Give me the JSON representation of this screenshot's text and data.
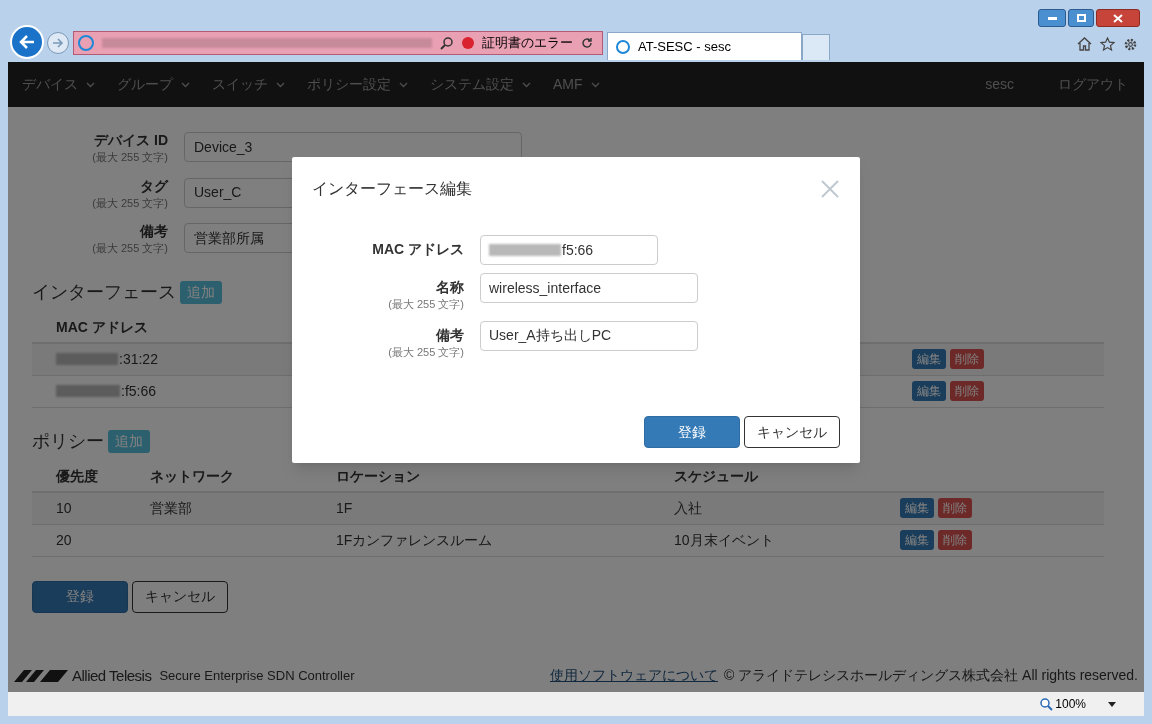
{
  "browser": {
    "cert_error": "証明書のエラー",
    "tab_title": "AT-SESC - sesc",
    "zoom": "100%"
  },
  "navbar": {
    "menus": [
      "デバイス",
      "グループ",
      "スイッチ",
      "ポリシー設定",
      "システム設定",
      "AMF"
    ],
    "user": "sesc",
    "logout": "ログアウト"
  },
  "device_form": [
    {
      "label": "デバイス ID",
      "hint": "(最大 255 文字)",
      "value": "Device_3"
    },
    {
      "label": "タグ",
      "hint": "(最大 255 文字)",
      "value": "User_C"
    },
    {
      "label": "備考",
      "hint": "(最大 255 文字)",
      "value": "営業部所属"
    }
  ],
  "interfaces": {
    "title": "インターフェース",
    "add_button": "追加",
    "columns": [
      "MAC アドレス"
    ],
    "rows": [
      {
        "mac": ":31:22",
        "edit": "編集",
        "delete": "削除"
      },
      {
        "mac": ":f5:66",
        "edit": "編集",
        "delete": "削除"
      }
    ]
  },
  "policies": {
    "title": "ポリシー",
    "add_button": "追加",
    "columns": [
      "優先度",
      "ネットワーク",
      "ロケーション",
      "スケジュール"
    ],
    "rows": [
      {
        "priority": "10",
        "network": "営業部",
        "location": "1F",
        "schedule": "入社",
        "edit": "編集",
        "delete": "削除"
      },
      {
        "priority": "20",
        "location": "1Fカンファレンスルーム",
        "schedule": "10月末イベント",
        "edit": "編集",
        "delete": "削除"
      }
    ]
  },
  "form_buttons": [
    {
      "label": "登録",
      "kind": "primary"
    },
    {
      "label": "キャンセル",
      "kind": "default"
    }
  ],
  "footer": {
    "brand": "Allied Telesis",
    "product": "Secure Enterprise SDN Controller",
    "link": "使用ソフトウェアについて",
    "copyright": "© アライドテレシスホールディングス株式会社 All rights reserved."
  },
  "modal": {
    "title": "インターフェース編集",
    "fields": [
      {
        "label": "MAC アドレス",
        "value": "f5:66",
        "redacted": true
      },
      {
        "label": "名称",
        "hint": "(最大 255 文字)",
        "value": "wireless_interface",
        "redacted": false
      },
      {
        "label": "備考",
        "hint": "(最大 255 文字)",
        "value": "User_A持ち出しPC",
        "redacted": false
      }
    ],
    "buttons": [
      {
        "label": "登録",
        "kind": "primary"
      },
      {
        "label": "キャンセル",
        "kind": "default"
      }
    ]
  }
}
